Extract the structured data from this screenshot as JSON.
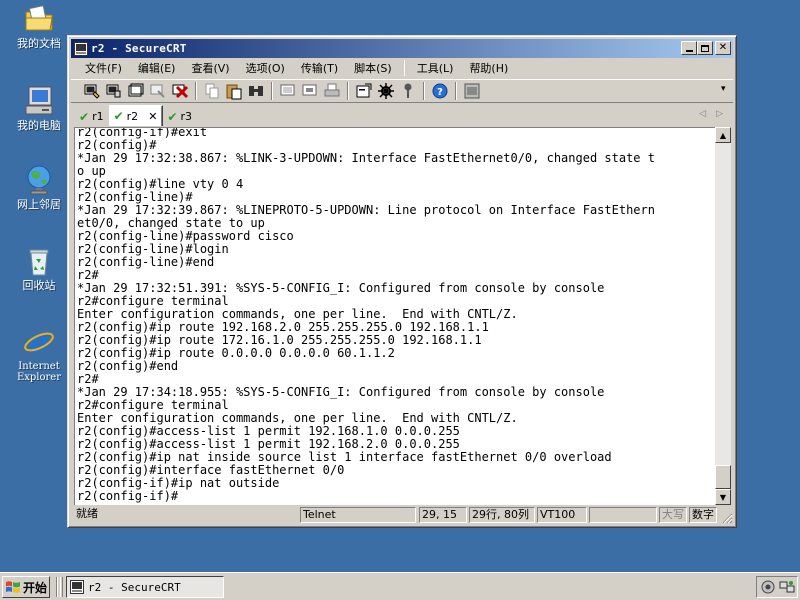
{
  "desktop": {
    "icons": [
      {
        "label": "我的文档",
        "icon": "my-documents-icon"
      },
      {
        "label": "我的电脑",
        "icon": "my-computer-icon"
      },
      {
        "label": "网上邻居",
        "icon": "network-icon"
      },
      {
        "label": "回收站",
        "icon": "recycle-bin-icon"
      },
      {
        "label_line1": "Internet",
        "label_line2": "Explorer",
        "icon": "internet-explorer-icon"
      }
    ]
  },
  "window": {
    "title": "r2 - SecureCRT",
    "menu": [
      "文件(F)",
      "编辑(E)",
      "查看(V)",
      "选项(O)",
      "传输(T)",
      "脚本(S)",
      "工具(L)",
      "帮助(H)"
    ],
    "tabs": [
      {
        "label": "r1",
        "active": false
      },
      {
        "label": "r2",
        "active": true
      },
      {
        "label": "r3",
        "active": false
      }
    ],
    "close_tab_glyph": "✕",
    "terminal_lines": [
      "r2(config-if)#exit",
      "r2(config)#",
      "*Jan 29 17:32:38.867: %LINK-3-UPDOWN: Interface FastEthernet0/0, changed state t",
      "o up",
      "r2(config)#line vty 0 4",
      "r2(config-line)#",
      "*Jan 29 17:32:39.867: %LINEPROTO-5-UPDOWN: Line protocol on Interface FastEthern",
      "et0/0, changed state to up",
      "r2(config-line)#password cisco",
      "r2(config-line)#login",
      "r2(config-line)#end",
      "r2#",
      "*Jan 29 17:32:51.391: %SYS-5-CONFIG_I: Configured from console by console",
      "r2#configure terminal",
      "Enter configuration commands, one per line.  End with CNTL/Z.",
      "r2(config)#ip route 192.168.2.0 255.255.255.0 192.168.1.1",
      "r2(config)#ip route 172.16.1.0 255.255.255.0 192.168.1.1",
      "r2(config)#ip route 0.0.0.0 0.0.0.0 60.1.1.2",
      "r2(config)#end",
      "r2#",
      "*Jan 29 17:34:18.955: %SYS-5-CONFIG_I: Configured from console by console",
      "r2#configure terminal",
      "Enter configuration commands, one per line.  End with CNTL/Z.",
      "r2(config)#access-list 1 permit 192.168.1.0 0.0.0.255",
      "r2(config)#access-list 1 permit 192.168.2.0 0.0.0.255",
      "r2(config)#ip nat inside source list 1 interface fastEthernet 0/0 overload",
      "r2(config)#interface fastEthernet 0/0",
      "r2(config-if)#ip nat outside",
      "r2(config-if)#"
    ],
    "status": {
      "ready": "就绪",
      "protocol": "Telnet",
      "cursor": "29, 15",
      "size": "29行, 80列",
      "terminal_type": "VT100",
      "caps": "大写",
      "num": "数字"
    }
  },
  "taskbar": {
    "start_label": "开始",
    "task_title": "r2 - SecureCRT"
  }
}
